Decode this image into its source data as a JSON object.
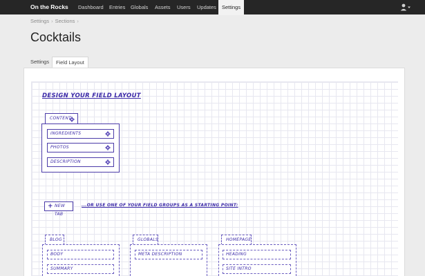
{
  "nav": {
    "brand": "On the Rocks",
    "items": [
      {
        "label": "Dashboard"
      },
      {
        "label": "Entries"
      },
      {
        "label": "Globals"
      },
      {
        "label": "Assets"
      },
      {
        "label": "Users"
      },
      {
        "label": "Updates"
      },
      {
        "label": "Settings",
        "active": true
      }
    ],
    "user_icon": "user-icon"
  },
  "breadcrumb": [
    "Settings",
    "Sections"
  ],
  "page_title": "Cocktails",
  "tabs": [
    {
      "label": "Settings"
    },
    {
      "label": "Field Layout",
      "active": true
    }
  ],
  "designer": {
    "title": "Design your field layout",
    "content_tab": {
      "label": "Content",
      "fields": [
        "Ingredients",
        "Photos",
        "Description"
      ]
    },
    "new_tab_label": "New Tab",
    "or_text": "...or use one of your field groups as a starting point:",
    "groups": [
      {
        "label": "Blog",
        "fields": [
          "Body",
          "Summary"
        ]
      },
      {
        "label": "Globals",
        "fields": [
          "Meta Description"
        ]
      },
      {
        "label": "Homepage",
        "fields": [
          "Heading",
          "Site Intro"
        ]
      }
    ]
  },
  "colors": {
    "accent": "#3c2aa8",
    "nav_bg": "#262626"
  }
}
